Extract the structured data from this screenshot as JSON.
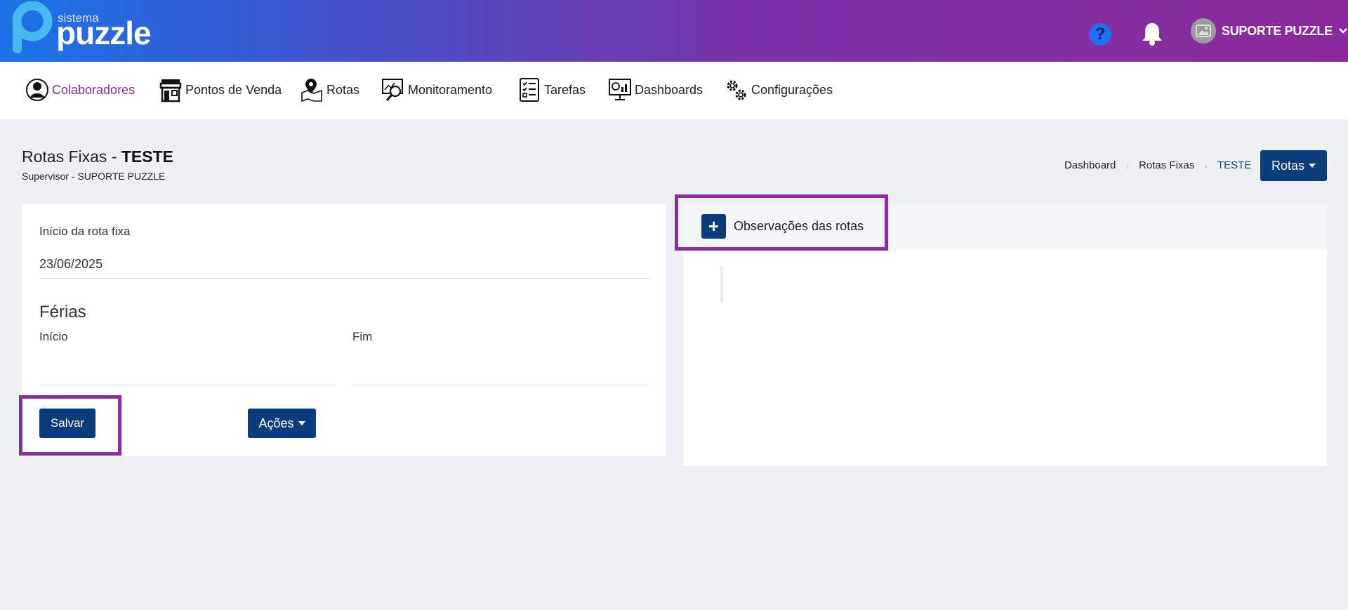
{
  "brand": {
    "small": "sistema",
    "big": "puzzle"
  },
  "header": {
    "help_symbol": "?",
    "user_name": "SUPORTE PUZZLE"
  },
  "nav": {
    "items": [
      {
        "label": "Colaboradores",
        "icon": "user-circle-icon",
        "active": true
      },
      {
        "label": "Pontos de Venda",
        "icon": "store-icon"
      },
      {
        "label": "Rotas",
        "icon": "map-pin-icon"
      },
      {
        "label": "Monitoramento",
        "icon": "monitor-search-icon"
      },
      {
        "label": "Tarefas",
        "icon": "checklist-icon"
      },
      {
        "label": "Dashboards",
        "icon": "dashboard-monitor-icon"
      },
      {
        "label": "Configurações",
        "icon": "gears-icon"
      }
    ]
  },
  "page": {
    "title_prefix": "Rotas Fixas - ",
    "title_name": "TESTE",
    "subtitle": "Supervisor - SUPORTE PUZZLE"
  },
  "breadcrumb": {
    "items": [
      "Dashboard",
      "Rotas Fixas",
      "TESTE"
    ]
  },
  "rotas_button": {
    "label": "Rotas"
  },
  "form": {
    "inicio_rota_label": "Início da rota fixa",
    "inicio_rota_value": "23/06/2025",
    "ferias_title": "Férias",
    "ferias_inicio_label": "Início",
    "ferias_inicio_value": "",
    "ferias_fim_label": "Fim",
    "ferias_fim_value": "",
    "salvar_label": "Salvar",
    "acoes_label": "Ações"
  },
  "observacoes": {
    "plus": "+",
    "title": "Observações das rotas"
  },
  "colors": {
    "accent": "#8a2f9e",
    "primary_button": "#0b3c7c",
    "help": "#1f6ff0",
    "background": "#edf0f4"
  }
}
